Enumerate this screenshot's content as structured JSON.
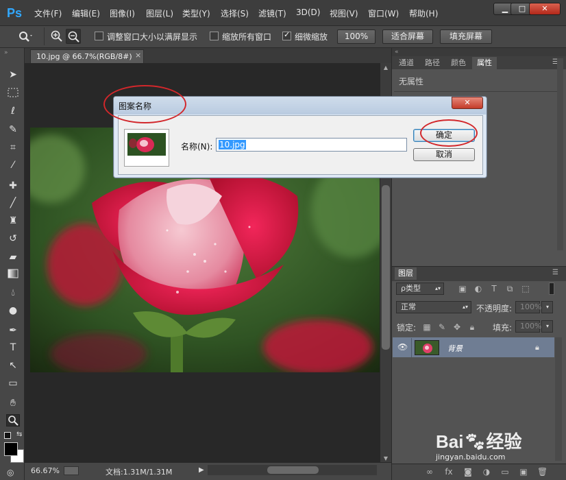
{
  "app": {
    "logo": "Ps"
  },
  "menu": [
    "文件(F)",
    "编辑(E)",
    "图像(I)",
    "图层(L)",
    "类型(Y)",
    "选择(S)",
    "滤镜(T)",
    "3D(D)",
    "视图(V)",
    "窗口(W)",
    "帮助(H)"
  ],
  "window_controls": {
    "minimize": "▁",
    "restore": "□",
    "close": "✕"
  },
  "options": {
    "resize_windows_label": "调整窗口大小以满屏显示",
    "zoom_all_label": "缩放所有窗口",
    "scrubby_label": "细微缩放",
    "zoom_100": "100%",
    "fit_screen": "适合屏幕",
    "fill_screen": "填充屏幕"
  },
  "document": {
    "tab_title": "10.jpg @ 66.7%(RGB/8#)",
    "tab_close": "×",
    "zoom": "66.67%",
    "doc_info": "文档:1.31M/1.31M"
  },
  "properties_panel": {
    "tabs": [
      "通道",
      "路径",
      "颜色",
      "属性"
    ],
    "content": "无属性"
  },
  "layers_panel": {
    "title": "图层",
    "filter_label": "ρ类型",
    "blend_mode": "正常",
    "opacity_label": "不透明度:",
    "opacity_value": "100%",
    "lock_label": "锁定:",
    "fill_label": "填充:",
    "fill_value": "100%",
    "layer_name": "背景"
  },
  "dialog": {
    "title": "图案名称",
    "name_label": "名称(N):",
    "name_value": "10.jpg",
    "ok": "确定",
    "cancel": "取消",
    "close": "✕"
  },
  "watermark": {
    "text": "Bai",
    "text2": "经验",
    "url": "jingyan.baidu.com"
  }
}
